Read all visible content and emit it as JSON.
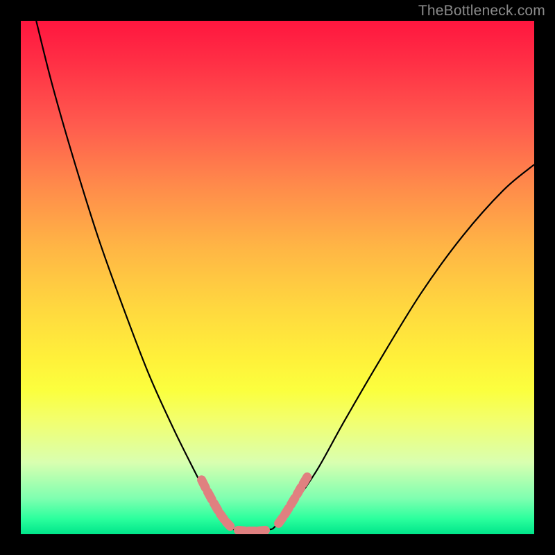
{
  "watermark": "TheBottleneck.com",
  "chart_data": {
    "type": "line",
    "title": "",
    "xlabel": "",
    "ylabel": "",
    "xlim": [
      0,
      100
    ],
    "ylim": [
      0,
      100
    ],
    "series": [
      {
        "name": "curve-left",
        "x": [
          3,
          6,
          10,
          15,
          20,
          25,
          30,
          35,
          37,
          39,
          41
        ],
        "y": [
          100,
          88,
          74,
          58,
          44,
          31,
          20,
          10,
          6,
          3,
          1
        ]
      },
      {
        "name": "curve-right",
        "x": [
          49,
          51,
          54,
          58,
          63,
          70,
          78,
          86,
          94,
          100
        ],
        "y": [
          1,
          3,
          7,
          13,
          22,
          34,
          47,
          58,
          67,
          72
        ]
      },
      {
        "name": "valley-flat",
        "x": [
          41,
          45,
          49
        ],
        "y": [
          1,
          0.5,
          1
        ]
      }
    ],
    "highlight_segments": [
      {
        "name": "left-pink-dashes",
        "points": [
          {
            "x": 35.0,
            "y": 11.0
          },
          {
            "x": 36.2,
            "y": 8.6
          },
          {
            "x": 37.4,
            "y": 6.4
          },
          {
            "x": 38.6,
            "y": 4.3
          },
          {
            "x": 39.8,
            "y": 2.6
          },
          {
            "x": 41.0,
            "y": 1.3
          }
        ]
      },
      {
        "name": "valley-pink-dashes",
        "points": [
          {
            "x": 42.0,
            "y": 0.8
          },
          {
            "x": 44.0,
            "y": 0.6
          },
          {
            "x": 46.0,
            "y": 0.6
          },
          {
            "x": 48.0,
            "y": 0.8
          }
        ]
      },
      {
        "name": "right-pink-dashes",
        "points": [
          {
            "x": 50.0,
            "y": 1.8
          },
          {
            "x": 51.2,
            "y": 3.5
          },
          {
            "x": 52.4,
            "y": 5.4
          },
          {
            "x": 53.6,
            "y": 7.4
          },
          {
            "x": 54.8,
            "y": 9.5
          },
          {
            "x": 56.0,
            "y": 11.5
          }
        ]
      }
    ],
    "colors": {
      "curve": "#000000",
      "highlight": "#e08080"
    }
  }
}
